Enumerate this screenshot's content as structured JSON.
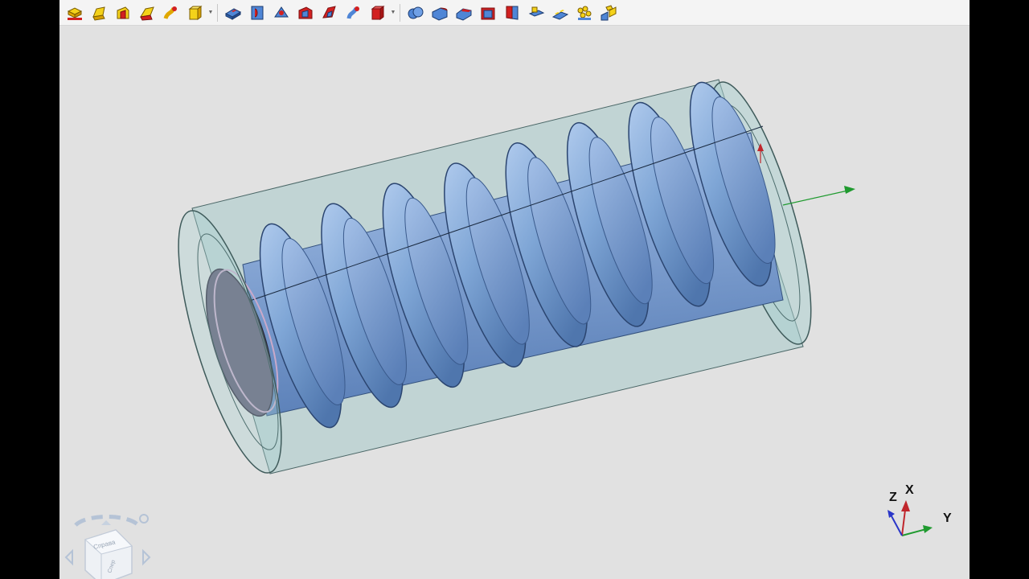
{
  "toolbar": {
    "groups": [
      [
        "extrusion-icon",
        "rotation-icon",
        "kinematic-icon",
        "loft-icon",
        "pipe-icon",
        "solid-primitive-icon"
      ],
      [
        "cut-extrusion-icon",
        "cut-rotation-icon",
        "cut-kinematic-icon",
        "cut-loft-icon",
        "cut-pipe-icon",
        "cut-primitive-icon"
      ],
      [
        "boolean-icon",
        "fillet-icon",
        "chamfer-icon",
        "shell-icon",
        "slope-icon",
        "rib-icon",
        "thread-icon",
        "array-icon",
        "mirror-icon"
      ]
    ]
  },
  "colors": {
    "background": "#e1e1e1",
    "thread": "#7fa6d6",
    "housing": "#9bc6c6",
    "end_face": "#5f5670",
    "axis_x": "#c0262c",
    "axis_y": "#1f9a2f",
    "axis_z": "#2a36c8"
  },
  "axes": {
    "x": "X",
    "y": "Y",
    "z": "Z"
  },
  "nav_cube": {
    "face_right": "Справа",
    "face_front": "Спер"
  }
}
